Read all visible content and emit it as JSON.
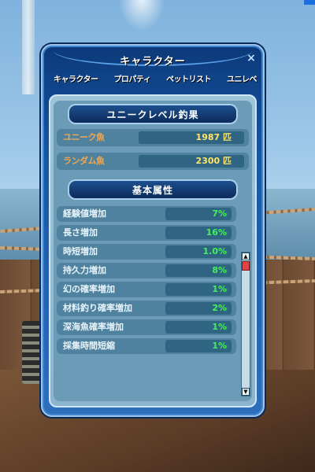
{
  "window": {
    "title": "キャラクター",
    "close_glyph": "×",
    "tabs": [
      "キャラクター",
      "プロパティ",
      "ペットリスト",
      "ユニレベ"
    ]
  },
  "unique_section": {
    "header": "ユニークレベル釣果",
    "rows": [
      {
        "label": "ユニーク魚",
        "value": "1987 匹"
      },
      {
        "label": "ランダム魚",
        "value": "2300 匹"
      }
    ]
  },
  "attributes_section": {
    "header": "基本属性",
    "rows": [
      {
        "label": "経験値増加",
        "value": "7%"
      },
      {
        "label": "長さ増加",
        "value": "16%"
      },
      {
        "label": "時短増加",
        "value": "1.0%"
      },
      {
        "label": "持久力増加",
        "value": "8%"
      },
      {
        "label": "幻の確率増加",
        "value": "1%"
      },
      {
        "label": "材料釣り確率増加",
        "value": "2%"
      },
      {
        "label": "深海魚確率増加",
        "value": "1%"
      },
      {
        "label": "採集時間短縮",
        "value": "1%"
      }
    ]
  },
  "scrollbar": {
    "up_glyph": "▲",
    "down_glyph": "▼"
  },
  "colors": {
    "window_frame": "#1656a6",
    "label_orange": "#f0a653",
    "value_yellow": "#ffe66a",
    "value_green": "#45f05a",
    "scroll_thumb": "#e24343"
  }
}
